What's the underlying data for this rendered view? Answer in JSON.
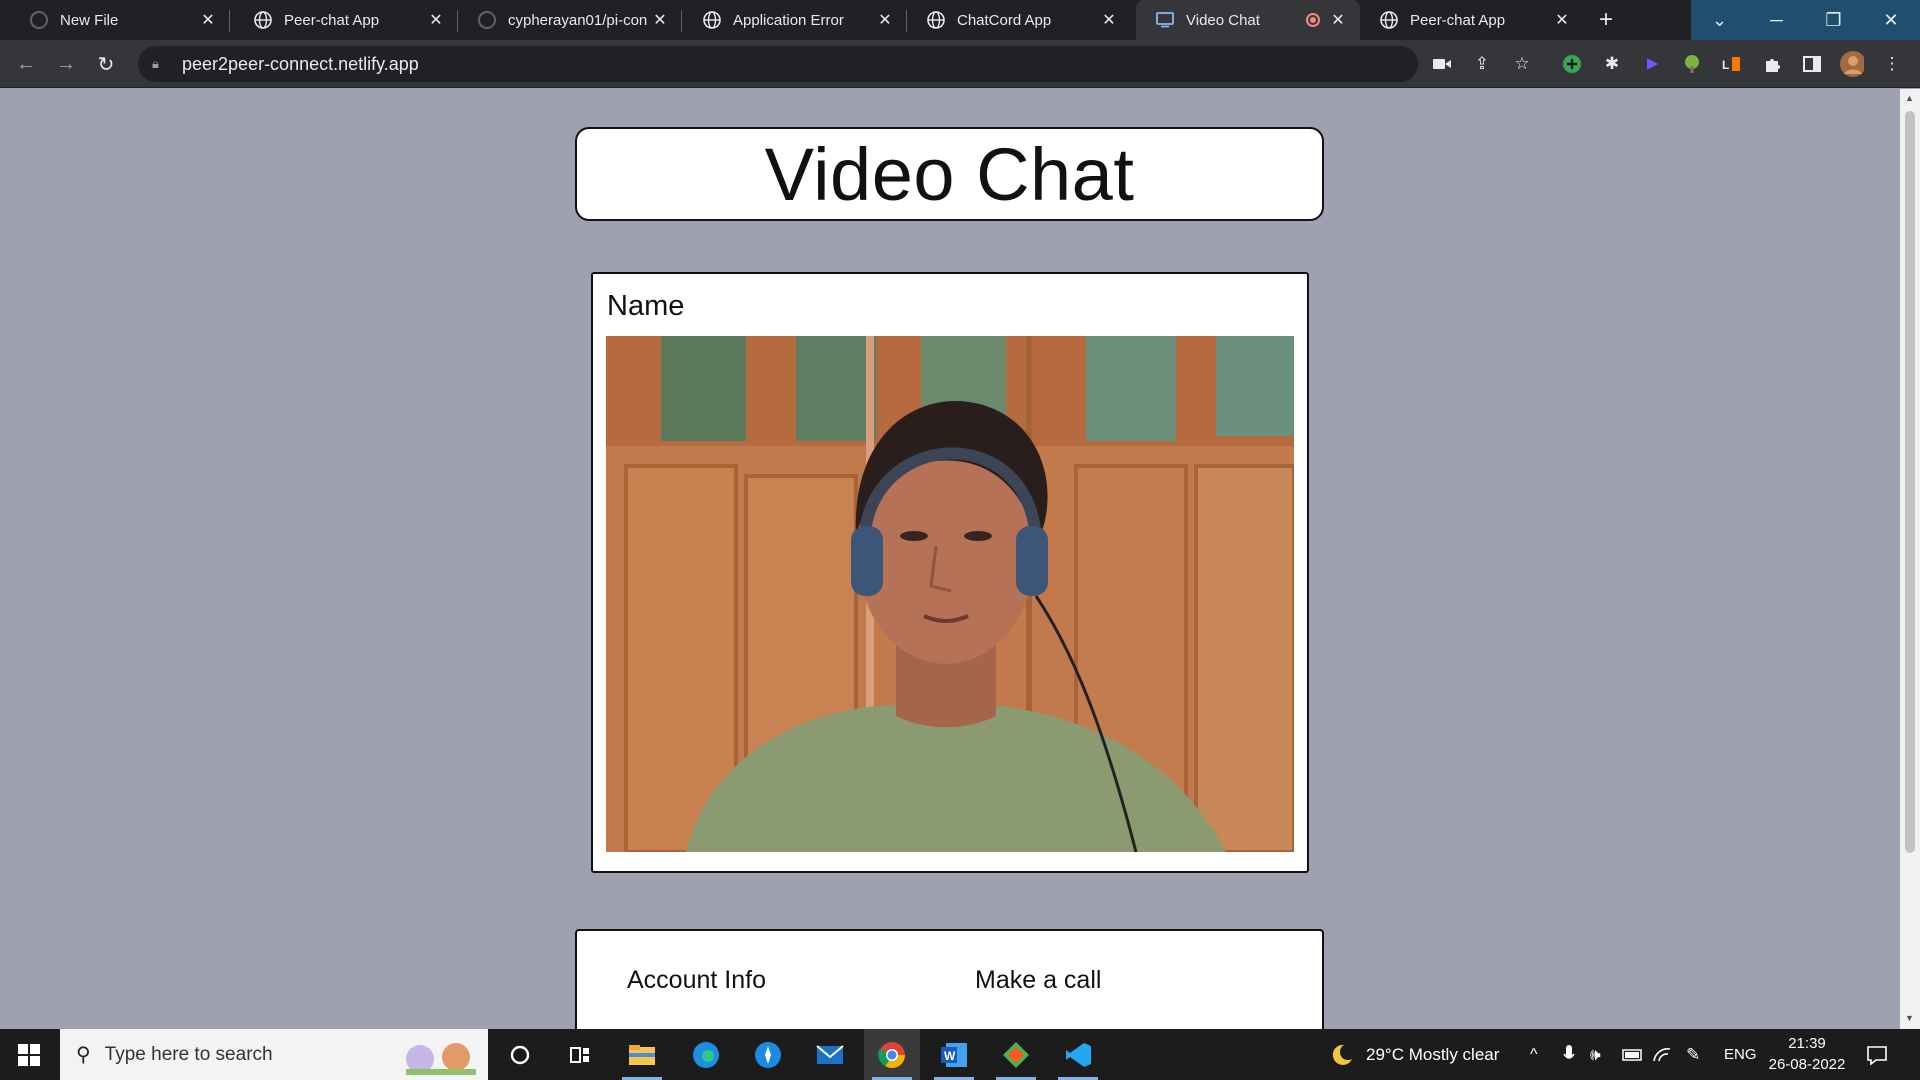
{
  "browser": {
    "tabs": [
      {
        "title": "New File",
        "icon": "github-icon",
        "active": false
      },
      {
        "title": "Peer-chat App",
        "icon": "globe-icon",
        "active": false
      },
      {
        "title": "cypherayan01/pi-con",
        "icon": "github-icon",
        "active": false
      },
      {
        "title": "Application Error",
        "icon": "globe-icon",
        "active": false
      },
      {
        "title": "ChatCord App",
        "icon": "globe-icon",
        "active": false
      },
      {
        "title": "Video Chat",
        "icon": "video-chat-icon",
        "active": true,
        "recording": true
      },
      {
        "title": "Peer-chat App",
        "icon": "globe-icon",
        "active": false
      }
    ],
    "url": "peer2peer-connect.netlify.app"
  },
  "page": {
    "header_title": "Video Chat",
    "video_card": {
      "name_label": "Name"
    },
    "bottom_card": {
      "account_info": "Account Info",
      "make_call": "Make a call"
    }
  },
  "taskbar": {
    "search_placeholder": "Type here to search",
    "weather": "29°C  Mostly clear",
    "language": "ENG",
    "time": "21:39",
    "date": "26-08-2022"
  },
  "colors": {
    "page_bg": "#9fa1b0",
    "card_bg": "#ffffff",
    "border": "#111111",
    "tabbar_bg": "#202124",
    "toolbar_bg": "#35363a",
    "taskbar_bg": "#1c1c1c"
  }
}
